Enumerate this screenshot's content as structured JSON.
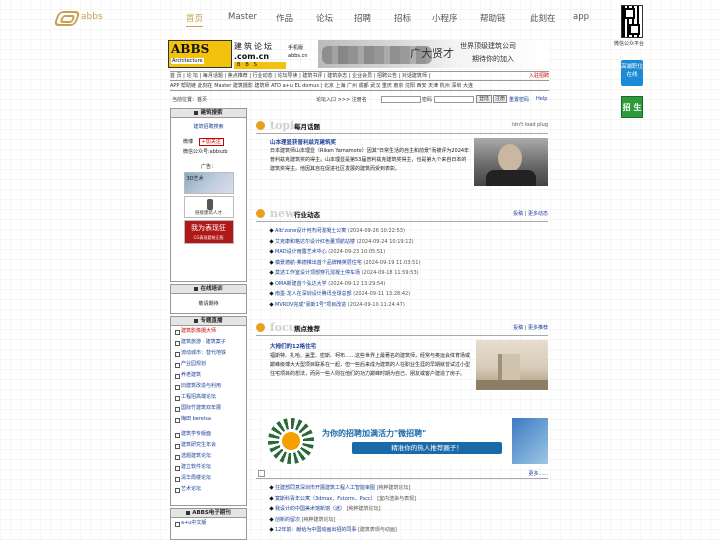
{
  "nav": {
    "logo_text": "abbs",
    "items": [
      {
        "label": "首页",
        "active": true
      },
      {
        "label": "Master"
      },
      {
        "label": "作品"
      },
      {
        "label": "论坛"
      },
      {
        "label": "招聘"
      },
      {
        "label": "招标"
      },
      {
        "label": "小程序"
      },
      {
        "label": "帮助链"
      },
      {
        "label": "此刻在"
      },
      {
        "label": "app"
      }
    ]
  },
  "right_rail": {
    "qr_label": "微信公众平台",
    "badge_label": "高端职位 在线",
    "zhaosheng": "招 生"
  },
  "banner": {
    "abbs": "ABBS",
    "architecture": "Architecture",
    "zhulun": "建筑论坛",
    "comcn": ".com.cn",
    "bbs": "BBS",
    "phone": "手机版",
    "site": "abbs.cn",
    "slogan_big": "广大贤才",
    "slogan_top": "世界顶级建筑公司",
    "slogan_bottom": "期待你的加入"
  },
  "links": {
    "row1": "首 页 | 论 坛 | 每月话题 | 焦点推荐 | 行业动态 | 论坛导读 | 建筑书评 | 建筑杂志 | 企业会员 | 招聘公告 | 对话建筑师 |",
    "row1_red": "入驻招聘",
    "row2": "APP 帮助链 此刻在 Master 建筑摄影 建筑师 ATD a+u EL domus | 北京 上海 广州 成都 武汉 重庆 南京 沈阳 西安 天津 杭州 深圳 大连"
  },
  "search": {
    "location": "当前位置：首页",
    "login_label": "论坛入口 >>> 注册名",
    "pwd_label": "密码",
    "login_btn": "登陆",
    "register": "注册",
    "reset": "重置密码",
    "help": "Help"
  },
  "left": {
    "box1_title": "建筑搜索",
    "box1_link": "建筑招聘搜索",
    "weibo": "微博",
    "follow": "+加关注",
    "wechat": "微信公众号:abbszb",
    "ads": "广告：",
    "ad1": "3D艺术",
    "ad2": "链接建筑人才",
    "ad3": "我为表现狂",
    "ad3_sub": "CG表现套装正版",
    "box2_title": "在线培训",
    "box2_link": "敬请期待",
    "box3_title": "专题直播",
    "topics": [
      {
        "label": "建筑影像摄大师",
        "red": true
      },
      {
        "label": "建筑旅游 · 建筑案子"
      },
      {
        "label": "流动城市：替代地铁"
      },
      {
        "label": "产业园规划"
      },
      {
        "label": "养老建筑"
      },
      {
        "label": "旧建筑改造与利用"
      },
      {
        "label": "工程招高端论坛"
      },
      {
        "label": "国际竹建筑双年展"
      },
      {
        "label": "梅田 bereisa"
      },
      {
        "label": "建筑学专版面"
      },
      {
        "label": "建筑研究生年会"
      },
      {
        "label": "选题建筑论坛"
      },
      {
        "label": "建立软件论坛"
      },
      {
        "label": "清华局楼论坛"
      },
      {
        "label": "艺术论坛"
      }
    ],
    "box4_title": "ABBS电子期刊",
    "journal": "a+u中文版"
  },
  "topic": {
    "ghost": "topic",
    "title": "每月话题",
    "broken": "ldn't load plug",
    "feat_title": "山本理显获普利兹克建筑奖",
    "feat_body": "日本建筑师山本理显（Riken Yamamoto）因其\"日常生活的自主和前景\"而被评为2024年普利兹克建筑奖的得主。山本理显是第53届普利兹克建筑奖得主，也是第九个来自日本的建筑奖得主。他因其自在促进社区发展的建筑而受到表彰。"
  },
  "news": {
    "ghost": "news",
    "title": "行业动态",
    "more_a": "投稿",
    "more_b": "更多动态",
    "items": [
      {
        "t": "Alb'zone设计何杰闲混凝土公寓",
        "d": "(2024-09-26 10:22:53)"
      },
      {
        "t": "艾克康和格达尔设计红色董顶航站楼",
        "d": "(2024-09-24 10:19:12)"
      },
      {
        "t": "MAD设计雨露艺术中心",
        "d": "(2024-09-23 10:05:51)"
      },
      {
        "t": "槙景德航-弗德推出首个品牌精英层住宅",
        "d": "(2024-09-19 11:03:51)"
      },
      {
        "t": "莫述工作室设计顶部穿孔混凝土停车场",
        "d": "(2024-09-18 11:59:53)"
      },
      {
        "t": "OMA新建首个弘达大学",
        "d": "(2024-09-12 13:29:54)"
      },
      {
        "t": "南墨·龙人在深圳设计腾讯全球总部",
        "d": "(2024-09-11 13:28:42)"
      },
      {
        "t": "MVRDV完成\"豪斯1号\"项目改造",
        "d": "(2024-09-10 11:24:47)"
      }
    ]
  },
  "focus": {
    "ghost": "focus",
    "title": "焦点推荐",
    "more_a": "投稿",
    "more_b": "更多推荐",
    "feat_title": "大拇们的12格住宅",
    "feat_body": "福斯特、扎哈、盖里、密斯、柯布……这些世界上最著名的建筑师，经常与奥运会体育场或巅峰级博大大型项目联系在一起，但一些后来成为建筑的人在职业生涯的早期就曾试过小型住宅项目的想法，而另一些人则在他们的功力巅峰时期为自己、朋友或客户建造了房子。"
  },
  "recruit_ad": {
    "line1": "为你的招聘加满活力\"微招聘\"",
    "line2": "精准你的热人推荐圈子！"
  },
  "forum": {
    "more": "更多......",
    "items": [
      {
        "t": "住建部同意深圳市开展建筑工程人工智能审图",
        "s": "[纯粹建筑论坛]"
      },
      {
        "t": "寞斯科青年公寓（3dmax、Fstorm、Pscc）",
        "s": "[室内渲染与表现]"
      },
      {
        "t": "我设计的中国美术馆新馆（迷）",
        "s": "[纯粹建筑论坛]"
      },
      {
        "t": "创新的留次",
        "s": "[纯粹建筑论坛]"
      },
      {
        "t": "12年前：献给为中国动画出招的同事",
        "s": "[建筑表现与动画]"
      }
    ]
  }
}
